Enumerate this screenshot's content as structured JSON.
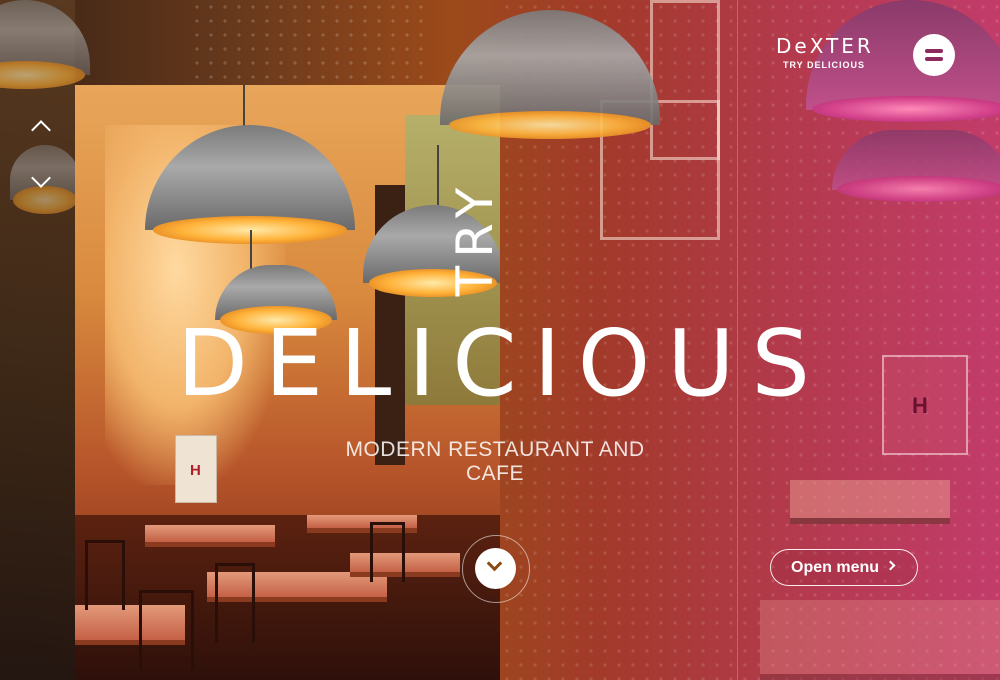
{
  "brand": {
    "logo_text": "DeXTER",
    "tagline": "TRY DELICIOUS"
  },
  "hero": {
    "kicker": "TRY",
    "title": "DELICIOUS",
    "subtitle": "MODERN RESTAURANT AND CAFE"
  },
  "actions": {
    "open_menu_label": "Open menu"
  },
  "decor": {
    "sign_letter": "H"
  },
  "icons": {
    "menu": "hamburger-icon",
    "slide_up": "chevron-up-icon",
    "slide_down": "chevron-down-icon",
    "scroll_down": "chevron-down-icon",
    "open_menu_arrow": "chevron-right-icon"
  },
  "colors": {
    "menu_icon": "#8c2a5c",
    "scroll_chevron": "#8a4a12",
    "gradient_left": "#9c4a1a",
    "gradient_right": "#c23c6a"
  }
}
